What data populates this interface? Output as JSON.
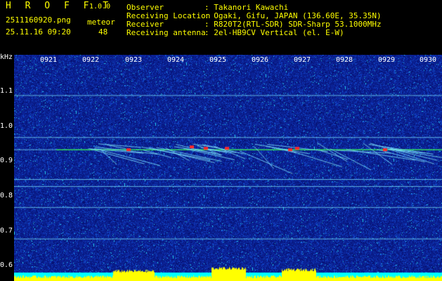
{
  "header": {
    "app_title": "H R O F F T",
    "version": "1.0.0",
    "filename": "2511160920.png",
    "datetime": "25.11.16 09:20",
    "meteor_label": "meteor",
    "meteor_count": "48",
    "info_labels": [
      "Observer",
      "Receiving Location",
      "Receiver",
      "Receiving antenna"
    ],
    "info_values": [
      ": Takanori Kawachi",
      ": Ogaki, Gifu, JAPAN (136.60E, 35.35N)",
      ": R820T2(RTL-SDR) SDR-Sharp 53.1000MHz",
      ": 2el-HB9CV Vertical (el. E-W)"
    ]
  },
  "axis": {
    "unit_label": "kHz",
    "y_ticks": [
      "1.1",
      "1.0",
      "0.9",
      "0.8",
      "0.7",
      "0.6"
    ],
    "x_ticks": [
      "0921",
      "0922",
      "0923",
      "0924",
      "0925",
      "0926",
      "0927",
      "0928",
      "0929",
      "0930"
    ]
  },
  "colors": {
    "background": "#000000",
    "plot_base": "#0a1e8c",
    "header_yellow": "#ffff00",
    "header_green": "#22ff22",
    "trace_cyan": "#7fe8ff",
    "echo_red": "#ff2a2a",
    "spectrum_yellow": "#ffff00",
    "spectrum_cyan": "#00ffff"
  },
  "spectrogram": {
    "horizontal_lines_khz": [
      0.96,
      0.925,
      0.84,
      0.76,
      0.82,
      0.67,
      1.08
    ],
    "signal_band_khz": 0.925
  }
}
